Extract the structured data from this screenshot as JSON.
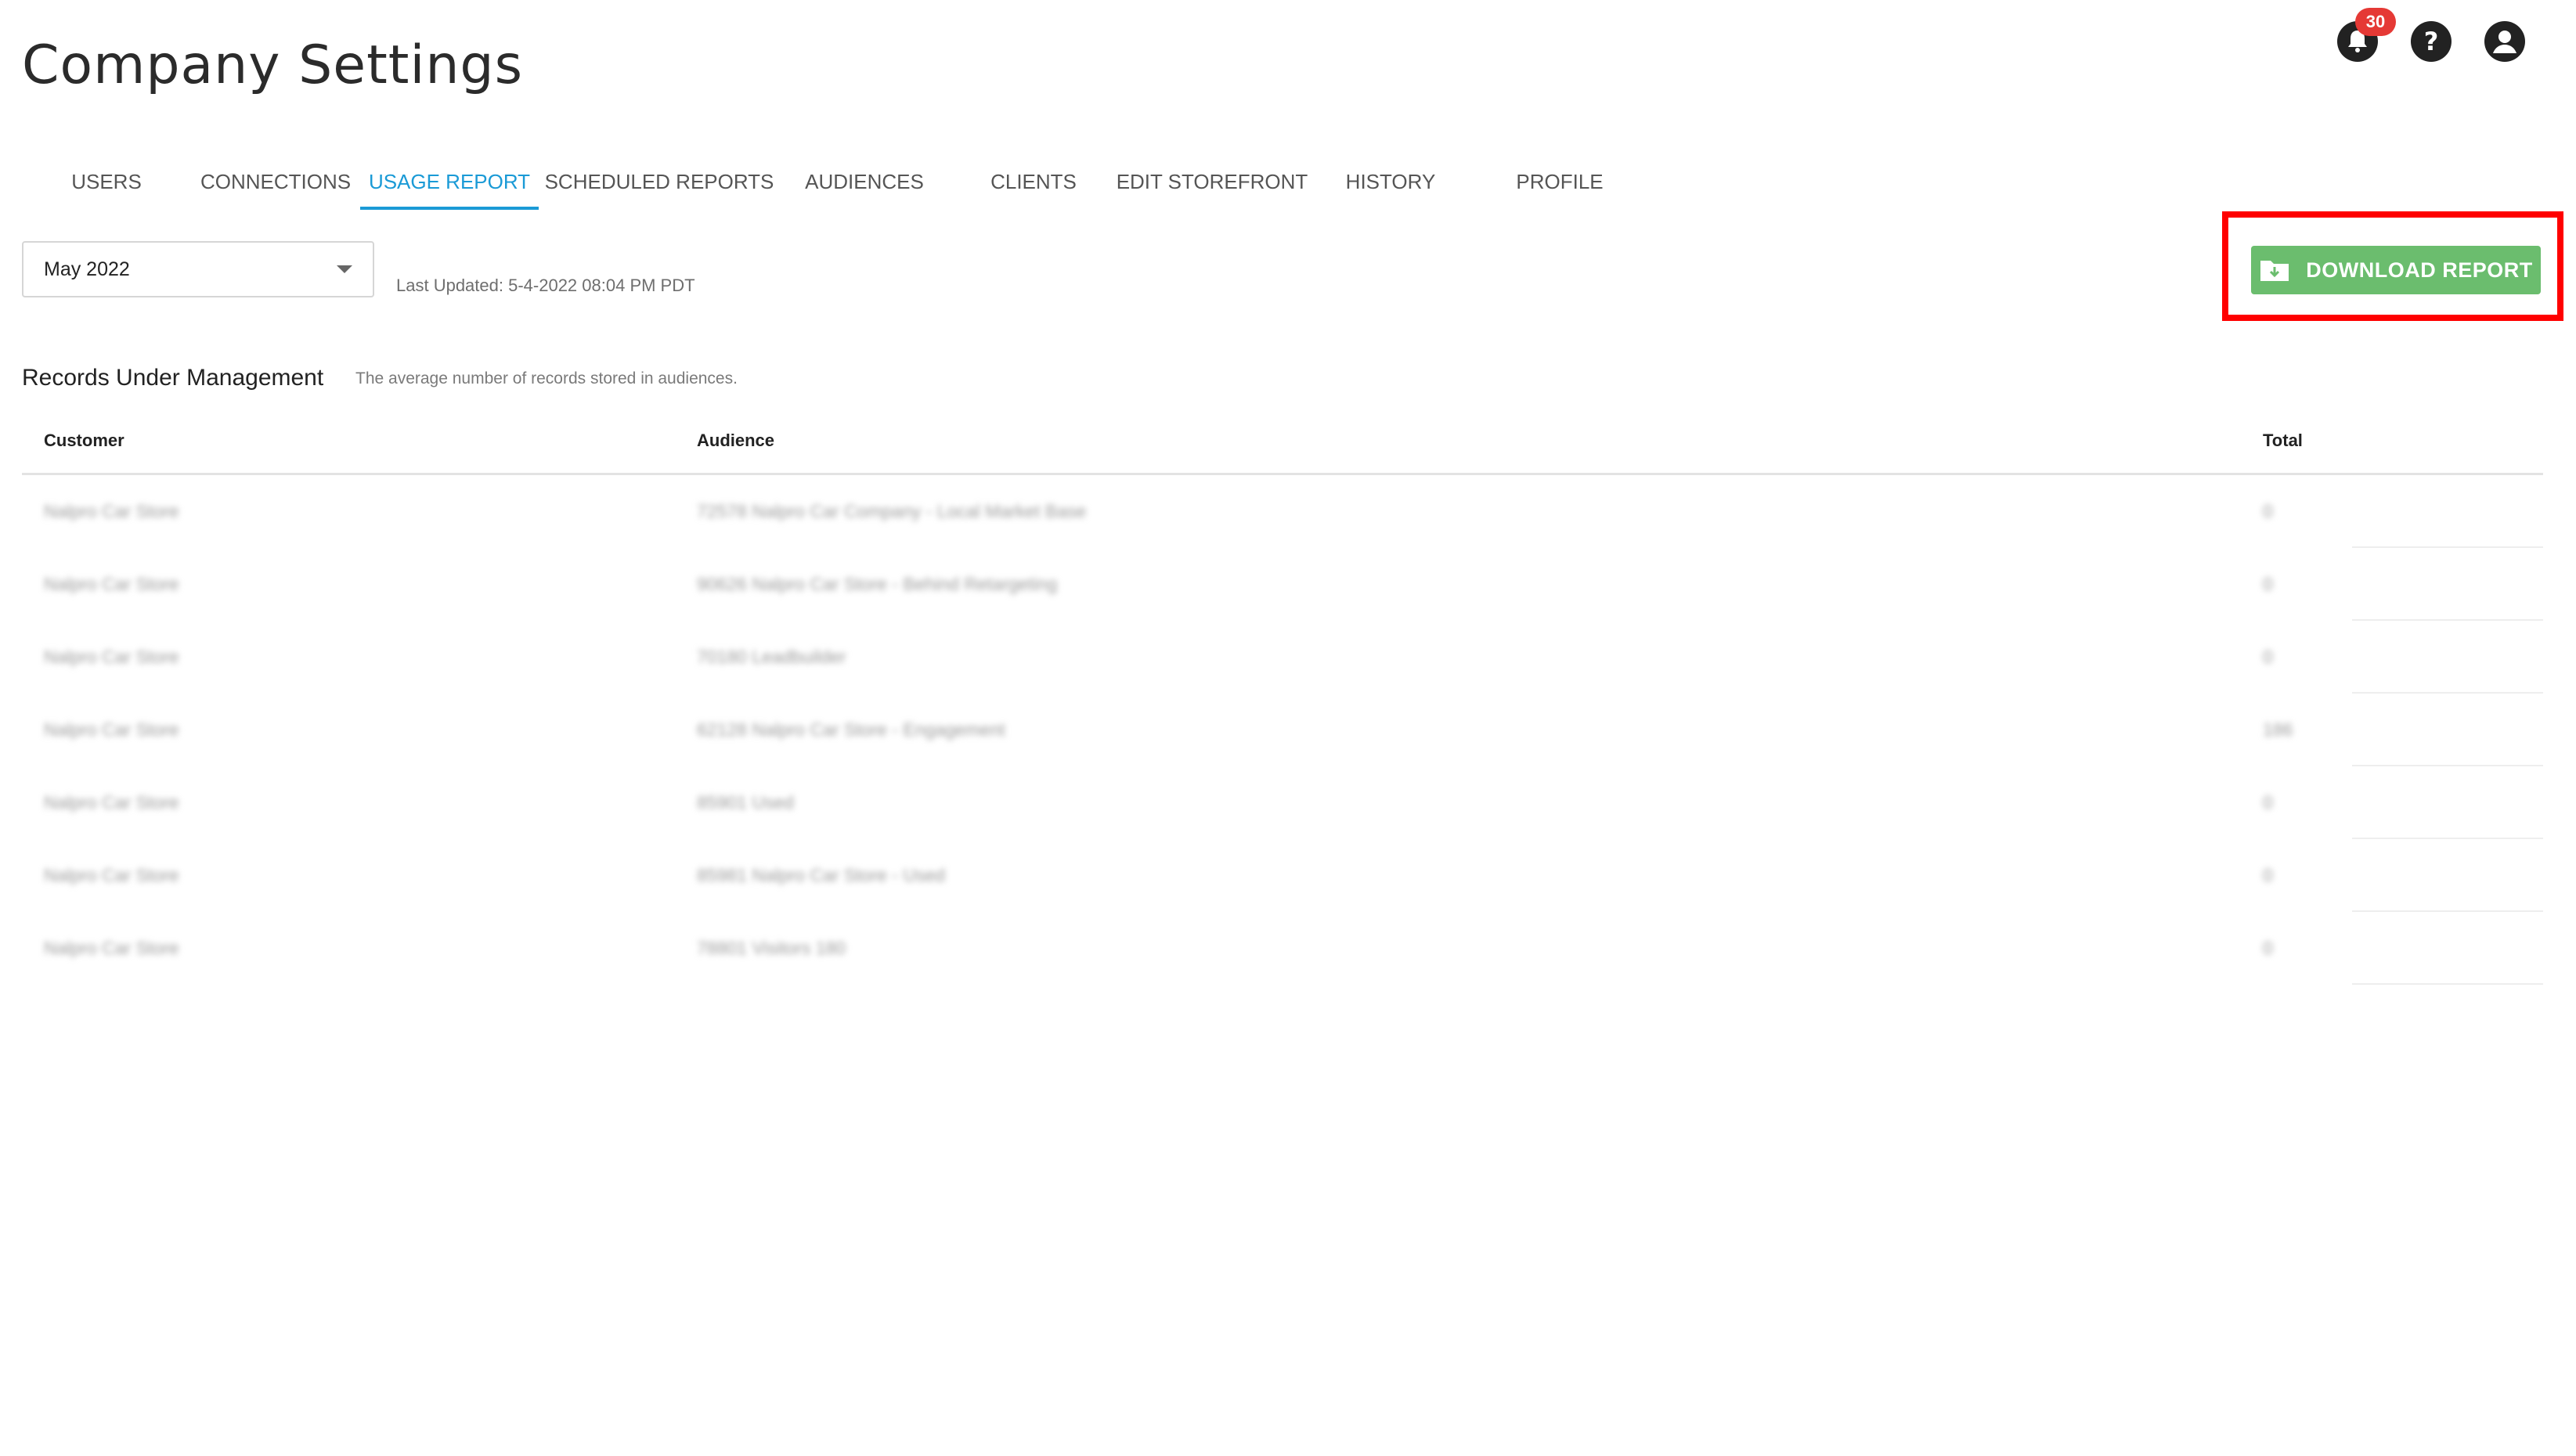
{
  "page": {
    "title": "Company Settings"
  },
  "header_icons": {
    "notifications_badge": "30",
    "icons": [
      "bell-icon",
      "help-icon",
      "account-icon"
    ]
  },
  "tabs": [
    {
      "label": "USERS",
      "active": false
    },
    {
      "label": "CONNECTIONS",
      "active": false
    },
    {
      "label": "USAGE REPORT",
      "active": true
    },
    {
      "label": "SCHEDULED REPORTS",
      "active": false
    },
    {
      "label": "AUDIENCES",
      "active": false
    },
    {
      "label": "CLIENTS",
      "active": false
    },
    {
      "label": "EDIT STOREFRONT",
      "active": false
    },
    {
      "label": "HISTORY",
      "active": false
    },
    {
      "label": "PROFILE",
      "active": false
    }
  ],
  "filters": {
    "month": "May 2022",
    "last_updated": "Last Updated: 5-4-2022 08:04 PM PDT"
  },
  "actions": {
    "download_label": "DOWNLOAD REPORT"
  },
  "section": {
    "title": "Records Under Management",
    "subtitle": "The average number of records stored in audiences."
  },
  "table": {
    "columns": [
      "Customer",
      "Audience",
      "Total"
    ],
    "rows": [
      {
        "customer": "Nalpro Car Store",
        "audience": "72578 Nalpro Car Company - Local Market Base",
        "total": "0"
      },
      {
        "customer": "Nalpro Car Store",
        "audience": "90626 Nalpro Car Store - Behind Retargeting",
        "total": "0"
      },
      {
        "customer": "Nalpro Car Store",
        "audience": "70180 Leadbuilder",
        "total": "0"
      },
      {
        "customer": "Nalpro Car Store",
        "audience": "62128 Nalpro Car Store - Engagement",
        "total": "186"
      },
      {
        "customer": "Nalpro Car Store",
        "audience": "85901 Used",
        "total": "0"
      },
      {
        "customer": "Nalpro Car Store",
        "audience": "85981 Nalpro Car Store - Used",
        "total": "0"
      },
      {
        "customer": "Nalpro Car Store",
        "audience": "78801 Visitors 180",
        "total": "0"
      }
    ]
  }
}
